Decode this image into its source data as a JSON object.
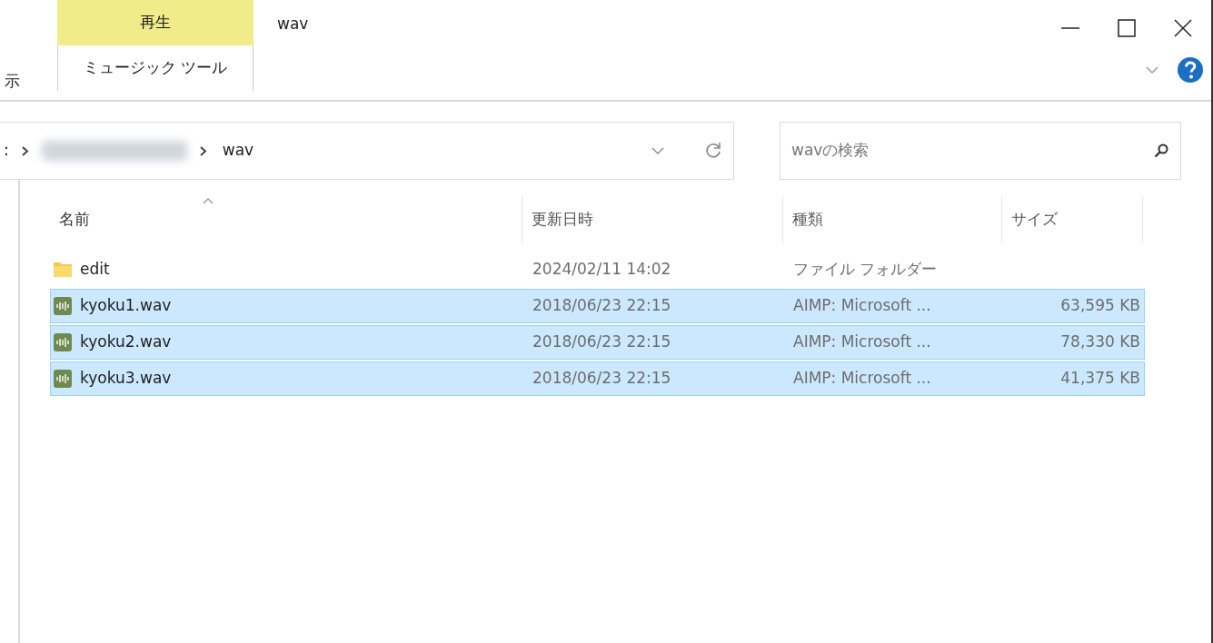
{
  "ribbon": {
    "context_tab": {
      "label": "再生",
      "group": "ミュージック ツール"
    },
    "partial_tab": "示"
  },
  "window": {
    "title": "wav"
  },
  "address_bar": {
    "prefix": ":",
    "segments": [
      {
        "label": "wav"
      }
    ]
  },
  "search": {
    "placeholder": "wavの検索"
  },
  "table": {
    "columns": [
      {
        "label": "名前",
        "sorted": true
      },
      {
        "label": "更新日時",
        "sorted": false
      },
      {
        "label": "種類",
        "sorted": false
      },
      {
        "label": "サイズ",
        "sorted": false
      }
    ],
    "rows": [
      {
        "kind": "folder",
        "name": "edit",
        "modified": "2024/02/11 14:02",
        "type": "ファイル フォルダー",
        "selected": false
      },
      {
        "kind": "audio",
        "name": "kyoku1.wav",
        "modified": "2018/06/23 22:15",
        "type": "AIMP: Microsoft ...",
        "size": "63,595 KB",
        "selected": true
      },
      {
        "kind": "audio",
        "name": "kyoku2.wav",
        "modified": "2018/06/23 22:15",
        "type": "AIMP: Microsoft ...",
        "size": "78,330 KB",
        "selected": true
      },
      {
        "kind": "audio",
        "name": "kyoku3.wav",
        "modified": "2018/06/23 22:15",
        "type": "AIMP: Microsoft ...",
        "size": "41,375 KB",
        "selected": true
      }
    ]
  }
}
